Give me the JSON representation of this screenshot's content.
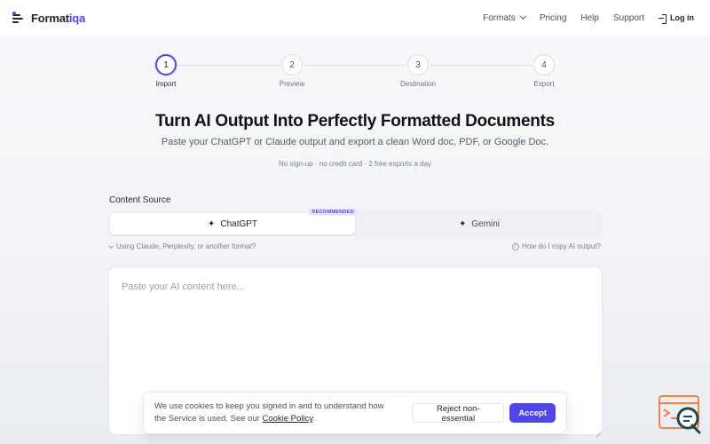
{
  "brand": {
    "name": "Formatiqa",
    "name_main": "Format",
    "name_accent": "iqa"
  },
  "nav": {
    "items": [
      {
        "label": "Formats",
        "has_dropdown": true
      },
      {
        "label": "Pricing"
      },
      {
        "label": "Help"
      },
      {
        "label": "Support"
      }
    ],
    "login_label": "Log in"
  },
  "stepper": {
    "steps": [
      {
        "number": "1",
        "label": "Import",
        "active": true
      },
      {
        "number": "2",
        "label": "Preview",
        "active": false
      },
      {
        "number": "3",
        "label": "Destination",
        "active": false
      },
      {
        "number": "4",
        "label": "Export",
        "active": false
      }
    ]
  },
  "hero": {
    "title": "Turn AI Output Into Perfectly Formatted Documents",
    "subtitle": "Paste your ChatGPT or Claude output and export a clean Word doc, PDF, or Google Doc.",
    "note": "No sign-up · no credit card · 2 free exports a day"
  },
  "content_source": {
    "label": "Content Source",
    "tabs": [
      {
        "label": "ChatGPT",
        "selected": true,
        "badge": "RECOMMENDED",
        "icon": "sparkle-icon"
      },
      {
        "label": "Gemini",
        "selected": false,
        "icon": "sparkle-icon"
      }
    ],
    "alt_link": "Using Claude, Perplexity, or another format?",
    "help_link": "How do I copy AI output?",
    "textarea_placeholder": "Paste your AI content here...",
    "textarea_value": ""
  },
  "cookie_banner": {
    "text_before": "We use cookies to keep you signed in and to understand how the Service is used. See our ",
    "link": "Cookie Policy",
    "text_after": ".",
    "reject_label": "Reject non-essential",
    "accept_label": "Accept"
  },
  "colors": {
    "accent": "#4f46e5",
    "chat_widget": "#f0834a",
    "chat_widget_dark": "#1f4a4a"
  }
}
